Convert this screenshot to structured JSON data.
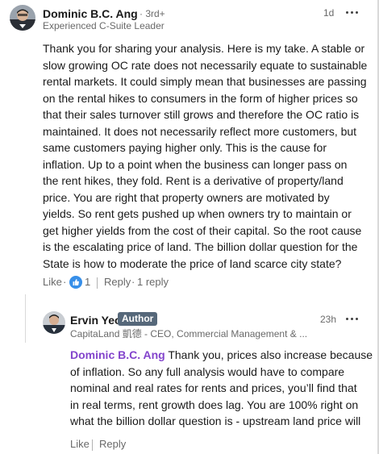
{
  "comment": {
    "author": "Dominic B.C. Ang",
    "degree": "· 3rd+",
    "headline": "Experienced C-Suite Leader",
    "time": "1d",
    "more_icon": "ellipsis-icon",
    "body_lines": [
      "Thank you for sharing your analysis. Here is my take. A stable or",
      "slow growing OC rate does not necessarily equate to sustainable",
      "rental markets. It could simply mean that businesses are passing",
      "on the rental hikes to consumers in the form of higher prices so",
      "that their sales turnover still grows and therefore the OC ratio is",
      "maintained. It does not necessarily reflect more customers, but",
      "same customers paying higher only. This is the cause for",
      "inflation. Up to a point when the business can longer pass on",
      "the rent hikes, they fold. Rent is a derivative of property/land",
      "price. You are right that property owners are motivated by",
      "yields. So rent gets pushed up when owners try to maintain or",
      "get higher yields from the cost of their capital. So the root cause",
      "is the escalating price of land. The billion dollar question for the",
      "State is how to moderate the price of land scarce city state?"
    ],
    "actions": {
      "like_label": "Like",
      "dot": "·",
      "reaction_icon": "like-reaction-icon",
      "reaction_count": "1",
      "reply_label": "Reply",
      "replies_count": "1 reply"
    }
  },
  "reply": {
    "author": "Ervin Yeo",
    "badge": "Author",
    "headline": "CapitaLand 凱德 - CEO, Commercial Management & ...",
    "time": "23h",
    "more_icon": "ellipsis-icon",
    "mention": "Dominic B.C. Ang",
    "first_line_rest": " Thank you, prices also increase because",
    "body_lines": [
      "of inflation. So any full analysis would have to compare",
      "nominal and real rates for rents and prices, you’ll find that",
      "in real terms, rent growth does lag. You are 100% right on",
      "what the billion dollar question is - upstream land price will"
    ],
    "actions": {
      "like_label": "Like",
      "reply_label": "Reply"
    }
  },
  "colors": {
    "mention": "#8344cc",
    "badge_bg": "#56687a",
    "like_blue": "#378fe9"
  }
}
